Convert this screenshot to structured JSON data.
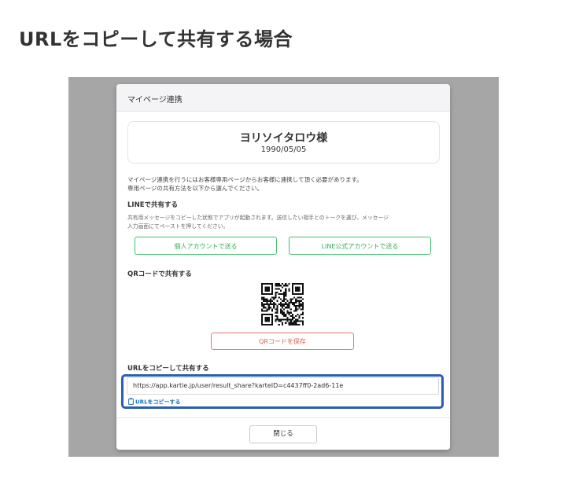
{
  "page": {
    "heading": "URLをコピーして共有する場合"
  },
  "modal": {
    "title": "マイページ連携",
    "customer": {
      "name": "ヨリソイタロウ様",
      "birthdate": "1990/05/05"
    },
    "description": [
      "マイページ連携を行うにはお客様専用ページからお客様に連携して頂く必要があります。",
      "専用ページの共有方法を以下から選んでください。"
    ],
    "line_section": {
      "title": "LINEで共有する",
      "note": [
        "共有用メッセージをコピーした状態でアプリが起動されます。送信したい相手とのトークを選び、メッセージ",
        "入力画面にてペーストを押してください。"
      ],
      "personal_button": "個人アカウントで送る",
      "official_button": "LINE公式アカウントで送る"
    },
    "qr_section": {
      "title": "QRコードで共有する",
      "save_button": "QRコードを保存"
    },
    "url_section": {
      "title": "URLをコピーして共有する",
      "url": "https://app.kartie.jp/user/result_share?karteID=c4437ff0-2ad6-11e",
      "copy_link": "URLをコピーする"
    },
    "close_button": "閉じる"
  },
  "colors": {
    "backdrop": "#a6a6a6",
    "line_green": "#2eaf58",
    "qr_red": "#e0604e",
    "link_blue": "#1f73c8",
    "highlight": "#2b5db3"
  },
  "icons": {
    "copy": "clipboard-icon"
  }
}
